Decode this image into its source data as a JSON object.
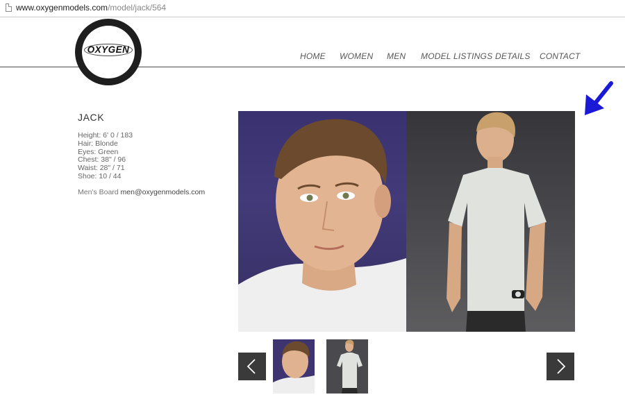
{
  "browser": {
    "url_domain": "www.oxygenmodels.com",
    "url_path": "/model/jack/564"
  },
  "logo": {
    "text": "OXYGEN"
  },
  "nav": {
    "items": [
      {
        "label": "HOME"
      },
      {
        "label": "WOMEN"
      },
      {
        "label": "MEN"
      },
      {
        "label": "MODEL LISTINGS"
      },
      {
        "label": "DETAILS"
      },
      {
        "label": "CONTACT"
      }
    ]
  },
  "model": {
    "name": "JACK",
    "stats": [
      "Height: 6' 0 / 183",
      "Hair: Blonde",
      "Eyes: Green",
      "Chest: 38\" / 96",
      "Waist: 28\" / 71",
      "Shoe: 10 / 44"
    ],
    "board_label": "Men's Board",
    "board_email": "men@oxygenmodels.com"
  },
  "gallery": {
    "thumbnails": [
      {
        "icon": "headshot-photo"
      },
      {
        "icon": "full-body-photo"
      }
    ]
  },
  "colors": {
    "header_line": "#4a4a4a",
    "arrow_button": "#3a3a3a",
    "annotation_arrow": "#1a1ad6"
  }
}
